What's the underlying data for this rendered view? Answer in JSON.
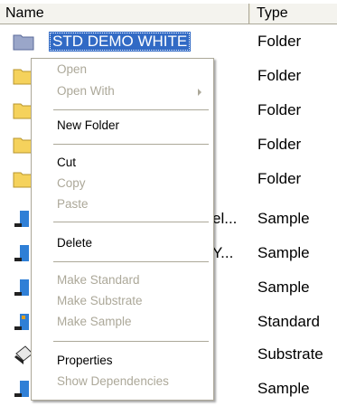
{
  "columns": {
    "name": "Name",
    "type": "Type"
  },
  "rows": [
    {
      "name": "STD DEMO WHITE",
      "type": "Folder",
      "icon": "folder-icon"
    },
    {
      "name": "",
      "type": "Folder",
      "icon": "folder-icon"
    },
    {
      "name": "",
      "type": "Folder",
      "icon": "folder-icon"
    },
    {
      "name": "",
      "type": "Folder",
      "icon": "folder-icon"
    },
    {
      "name": "",
      "type": "Folder",
      "icon": "folder-icon"
    },
    {
      "name": "el...",
      "type": "Sample",
      "icon": "sample-icon"
    },
    {
      "name": "Y...",
      "type": "Sample",
      "icon": "sample-icon"
    },
    {
      "name": "",
      "type": "Sample",
      "icon": "sample-icon"
    },
    {
      "name": "",
      "type": "Standard",
      "icon": "standard-icon"
    },
    {
      "name": "",
      "type": "Substrate",
      "icon": "substrate-icon"
    },
    {
      "name": "",
      "type": "Sample",
      "icon": "sample-icon"
    }
  ],
  "menu": {
    "open": "Open",
    "open_with": "Open With",
    "new_folder": "New Folder",
    "cut": "Cut",
    "copy": "Copy",
    "paste": "Paste",
    "delete": "Delete",
    "make_standard": "Make Standard",
    "make_substrate": "Make Substrate",
    "make_sample": "Make Sample",
    "properties": "Properties",
    "show_dependencies": "Show Dependencies"
  },
  "colors": {
    "selection": "#316ac5",
    "header": "#ece9d8",
    "disabled_text": "#aca899"
  }
}
